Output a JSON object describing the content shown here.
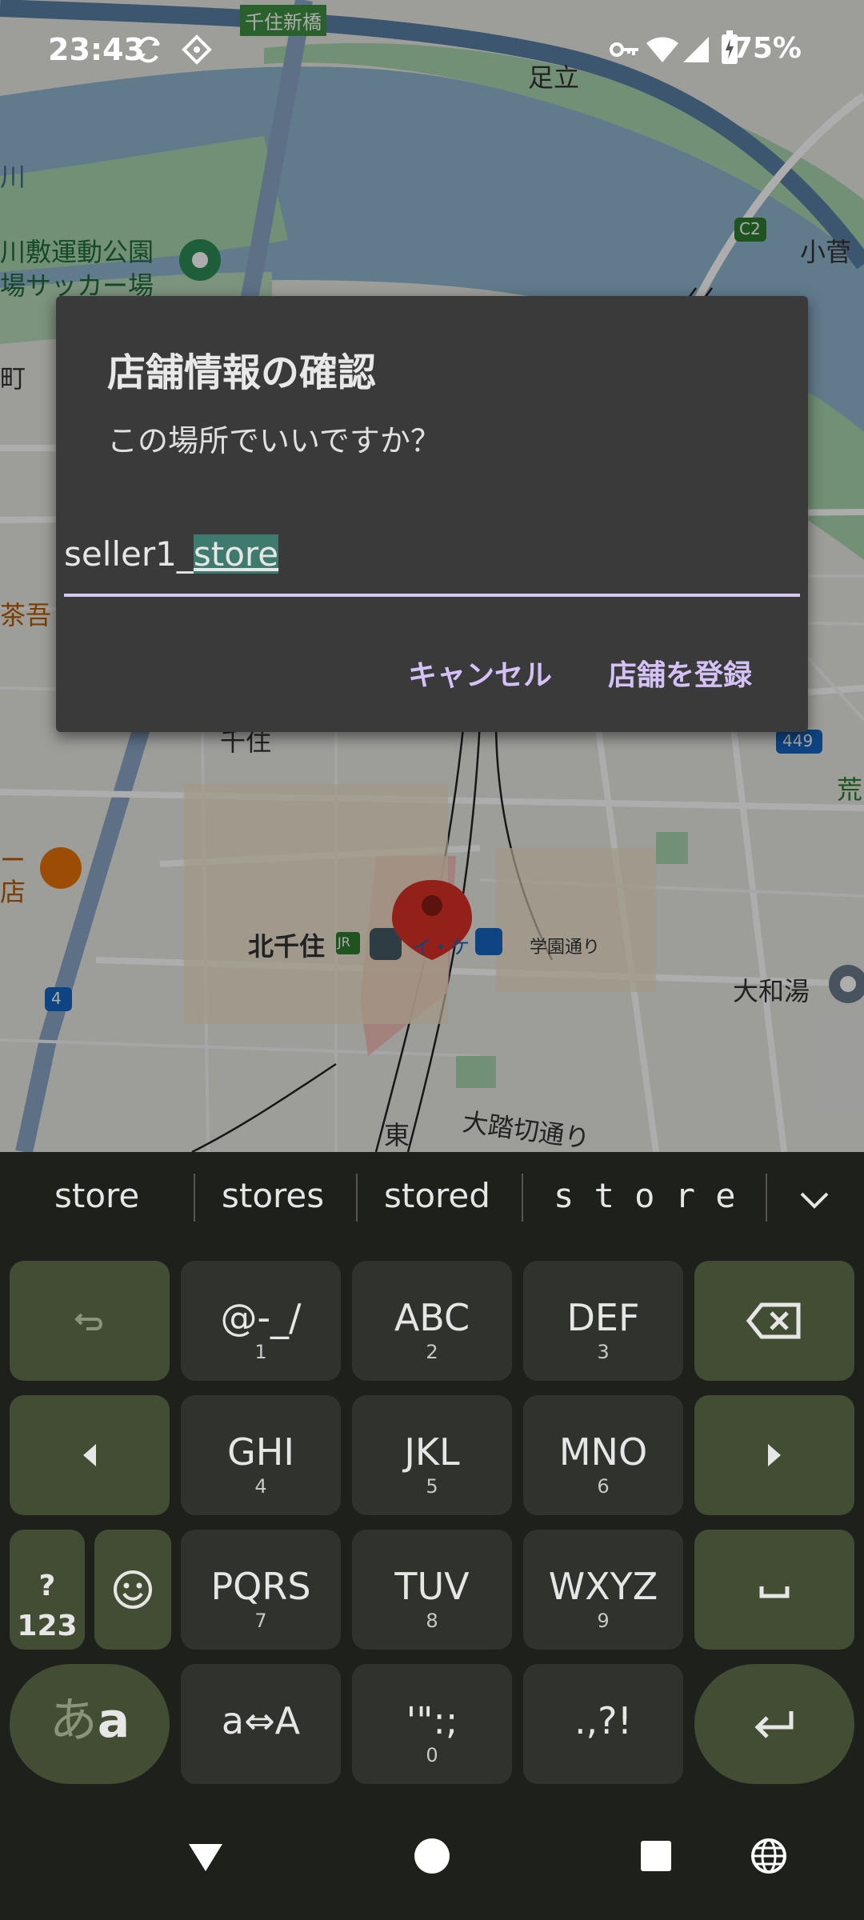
{
  "status_bar": {
    "time": "23:43",
    "battery_percent": "75%",
    "icons": [
      "sync-icon",
      "location-icon",
      "vpn-key-icon",
      "wifi-icon",
      "signal-icon",
      "battery-charging-icon"
    ]
  },
  "map": {
    "labels": {
      "senju_shinbashi": "千住新橋",
      "adachi": "足立",
      "kosuge": "小菅",
      "park_line1": "川敷運動公園",
      "park_line2": "場サッカー場",
      "river": "川",
      "machi": "町",
      "chaho": "茶吾",
      "senju": "千住",
      "shop_line1": "ー",
      "shop_line2": "店",
      "kitasenju": "北千住",
      "gakuen_dori": "学園通り",
      "yamato_yu": "大和湯",
      "ara": "荒",
      "ofumikiri": "大踏切通り",
      "higashi": "東",
      "road_c2": "C2",
      "road_449": "449",
      "road_4": "4",
      "jr_badge": "JR",
      "rail_badge": "イ・ケ"
    },
    "colors": {
      "water": "#8fb5cf",
      "park": "#a8d5ad",
      "land": "#e6e6e6",
      "pin": "#d93025"
    }
  },
  "dialog": {
    "title": "店舗情報の確認",
    "message": "この場所でいいですか？",
    "input_value_prefix": "seller1_",
    "input_value_selected": "store",
    "cancel_label": "キャンセル",
    "confirm_label": "店舗を登録"
  },
  "suggestions": [
    "store",
    "stores",
    "stored",
    "s t o r e"
  ],
  "keyboard": {
    "row1": [
      {
        "icon": "undo-icon"
      },
      {
        "main": "@-_/",
        "sub": "1"
      },
      {
        "main": "ABC",
        "sub": "2"
      },
      {
        "main": "DEF",
        "sub": "3"
      },
      {
        "icon": "backspace-icon"
      }
    ],
    "row2": [
      {
        "icon": "left-arrow-icon"
      },
      {
        "main": "GHI",
        "sub": "4"
      },
      {
        "main": "JKL",
        "sub": "5"
      },
      {
        "main": "MNO",
        "sub": "6"
      },
      {
        "icon": "right-arrow-icon"
      }
    ],
    "row3": [
      {
        "main": "?123"
      },
      {
        "icon": "emoji-icon"
      },
      {
        "main": "PQRS",
        "sub": "7"
      },
      {
        "main": "TUV",
        "sub": "8"
      },
      {
        "main": "WXYZ",
        "sub": "9"
      },
      {
        "icon": "space-icon"
      }
    ],
    "row4": [
      {
        "main": "あa"
      },
      {
        "main": "a⇔A"
      },
      {
        "main": "'\":;",
        "sub": "0"
      },
      {
        "main": ".,?!"
      },
      {
        "icon": "enter-icon"
      }
    ],
    "colors": {
      "key": "#30332d",
      "function_key": "#434d33",
      "background": "#1e201b"
    }
  },
  "nav_bar": {
    "icons": [
      "back-icon",
      "home-icon",
      "recents-icon",
      "language-icon"
    ]
  }
}
